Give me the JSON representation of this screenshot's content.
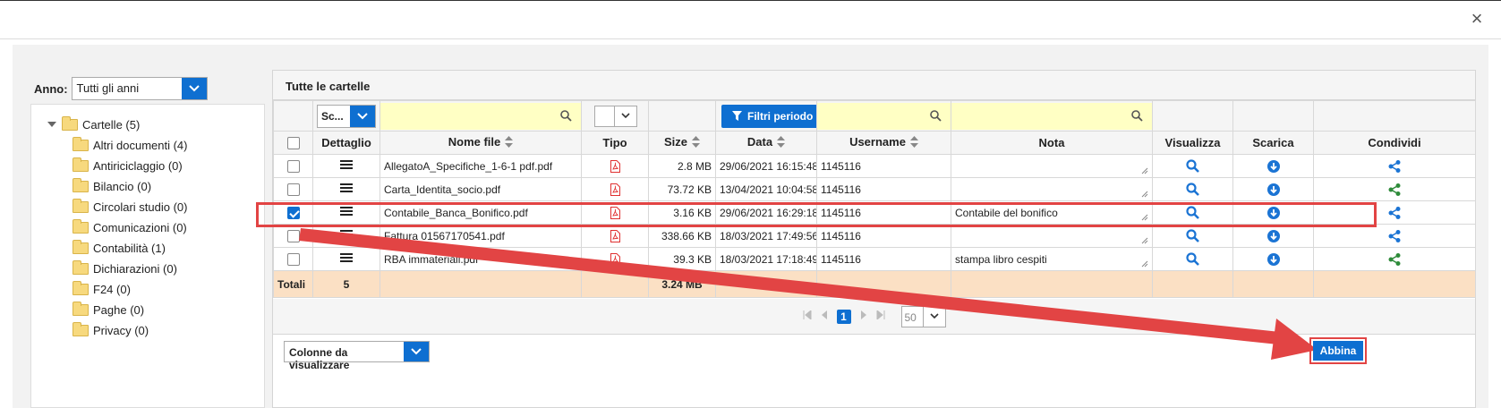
{
  "dialog": {
    "close_glyph": "×"
  },
  "filters": {
    "anno_label": "Anno:",
    "anno_value": "Tutti gli anni",
    "scadenza_value": "Sc...",
    "filtri_periodo_label": "Filtri periodo"
  },
  "tree": {
    "root_label": "Cartelle (5)",
    "items": [
      "Altri documenti (4)",
      "Antiriciclaggio (0)",
      "Bilancio (0)",
      "Circolari studio (0)",
      "Comunicazioni (0)",
      "Contabilità (1)",
      "Dichiarazioni (0)",
      "F24 (0)",
      "Paghe (0)",
      "Privacy (0)"
    ]
  },
  "panel": {
    "title": "Tutte le cartelle"
  },
  "table": {
    "columns": {
      "dettaglio": "Dettaglio",
      "nome_file": "Nome file",
      "tipo": "Tipo",
      "size": "Size",
      "data": "Data",
      "username": "Username",
      "nota": "Nota",
      "visualizza": "Visualizza",
      "scarica": "Scarica",
      "condividi": "Condividi"
    },
    "rows": [
      {
        "checked": false,
        "nome_file": "AllegatoA_Specifiche_1-6-1 pdf.pdf",
        "size": "2.8 MB",
        "data": "29/06/2021 16:15:48",
        "username": "1145116",
        "nota": "",
        "share_color": "#1b74d4"
      },
      {
        "checked": false,
        "nome_file": "Carta_Identita_socio.pdf",
        "size": "73.72 KB",
        "data": "13/04/2021 10:04:58",
        "username": "1145116",
        "nota": "",
        "share_color": "#2e8b3a"
      },
      {
        "checked": true,
        "nome_file": "Contabile_Banca_Bonifico.pdf",
        "size": "3.16 KB",
        "data": "29/06/2021 16:29:18",
        "username": "1145116",
        "nota": "Contabile del bonifico",
        "share_color": "#1b74d4"
      },
      {
        "checked": false,
        "nome_file": "Fattura 01567170541.pdf",
        "size": "338.66 KB",
        "data": "18/03/2021 17:49:56",
        "username": "1145116",
        "nota": "",
        "share_color": "#1b74d4"
      },
      {
        "checked": false,
        "nome_file": "RBA immateriali.pdf",
        "size": "39.3 KB",
        "data": "18/03/2021 17:18:49",
        "username": "1145116",
        "nota": "stampa libro  cespiti",
        "share_color": "#2e8b3a"
      }
    ],
    "totals": {
      "label": "Totali",
      "count": "5",
      "size": "3.24 MB"
    }
  },
  "pager": {
    "current_page": "1",
    "page_size": "50"
  },
  "footer": {
    "colonne_label": "Colonne da visualizzare",
    "abbina_label": "Abbina"
  },
  "colors": {
    "accent": "#0e6fd1",
    "highlight": "#e24444",
    "filter_bg": "#ffffc4",
    "totals_bg": "#fbe0c4"
  }
}
